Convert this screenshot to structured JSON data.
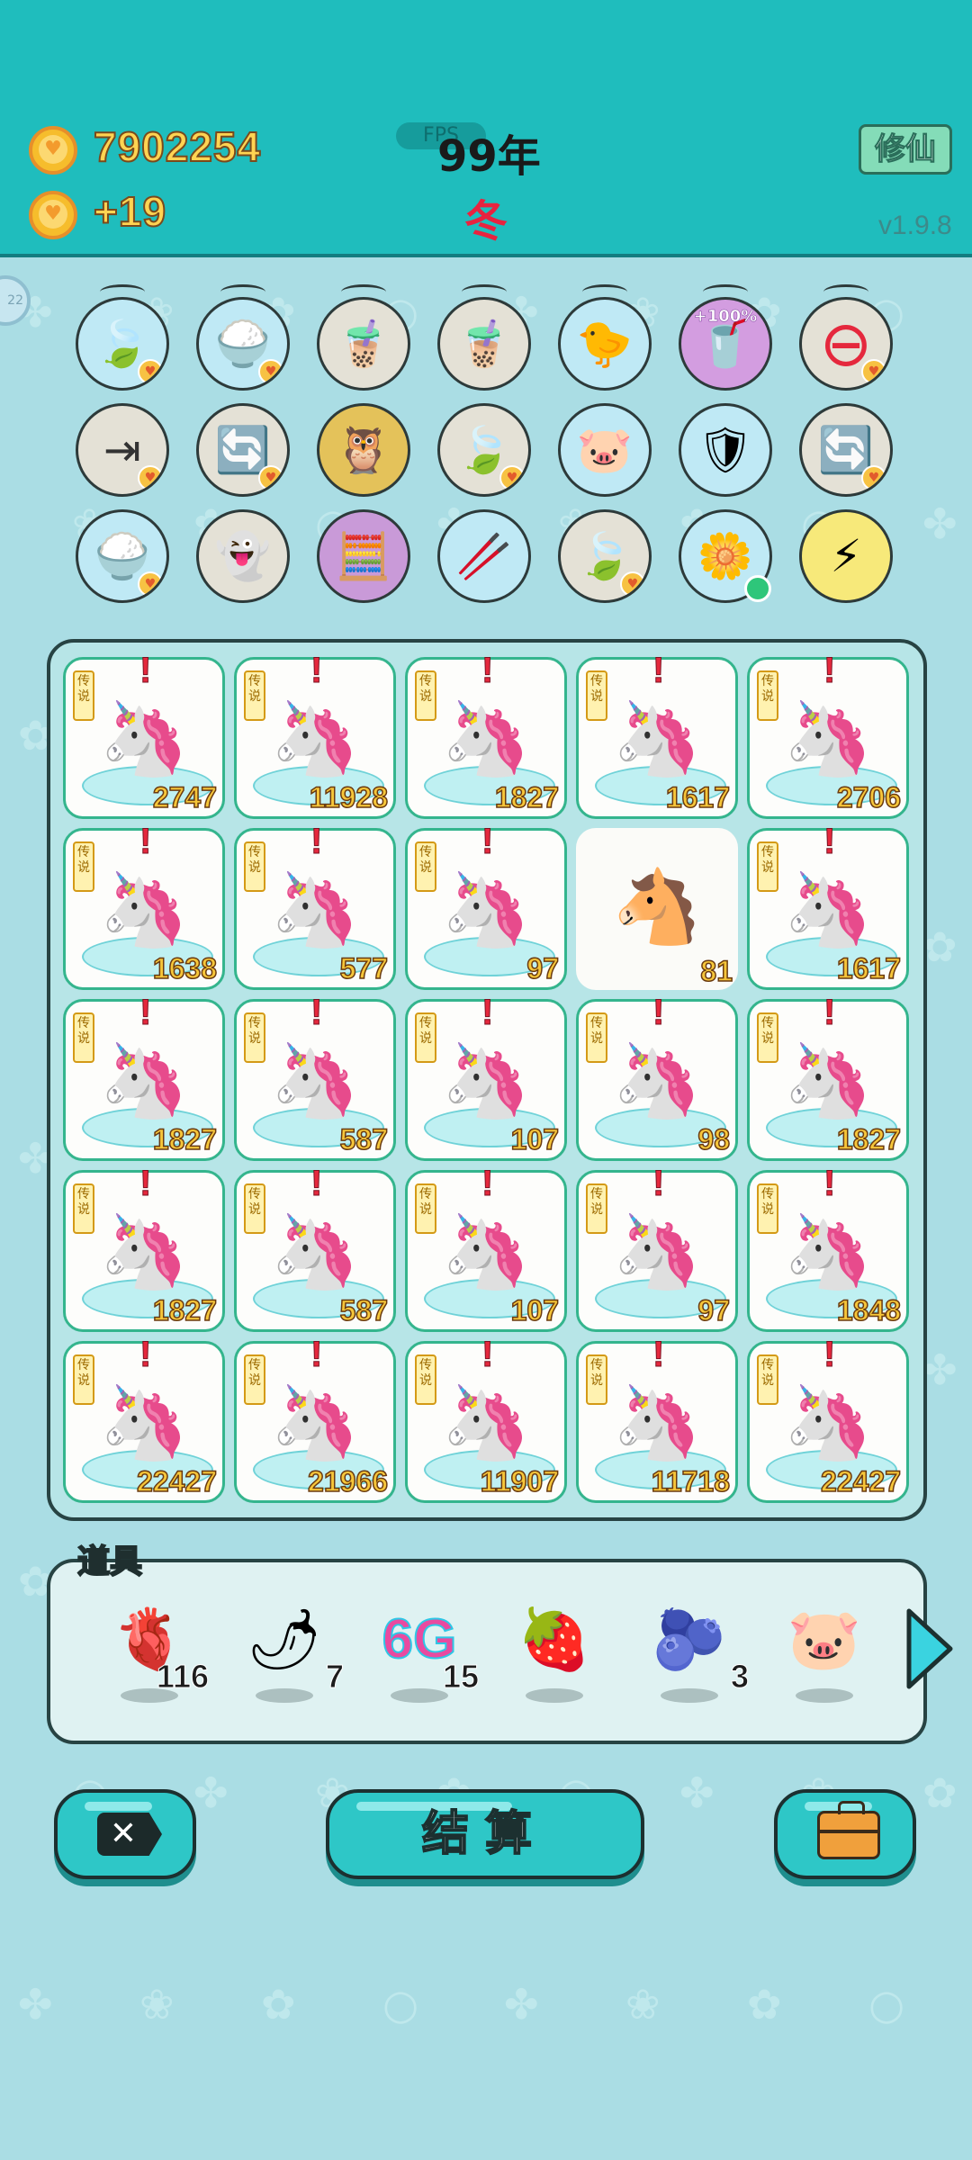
{
  "header": {
    "coins": "7902254",
    "coin_rate": "+19",
    "fps_label": "FPS",
    "year": "99年",
    "season": "冬",
    "mode_button": "修仙",
    "version": "v1.9.8"
  },
  "skills": [
    {
      "icon": "leaf-icon",
      "glyph": "🍃",
      "bg": "#bfe9f5",
      "badge": true
    },
    {
      "icon": "rice-bowl-icon",
      "glyph": "🍚",
      "bg": "#bfe9f5",
      "badge": true
    },
    {
      "icon": "bubble-tea-icon",
      "glyph": "🧋",
      "bg": "#e4e1d6",
      "badge": false
    },
    {
      "icon": "bubble-tea-icon",
      "glyph": "🧋",
      "bg": "#e4e1d6",
      "badge": false
    },
    {
      "icon": "chick-egg-icon",
      "glyph": "🐤",
      "bg": "#bfe9f5",
      "badge": false
    },
    {
      "icon": "bubble-tea-plus-icon",
      "glyph": "🥤",
      "bg": "#d39de0",
      "badge": false,
      "text": "+100%"
    },
    {
      "icon": "minus-icon",
      "glyph": "⊖",
      "bg": "#e4e1d6",
      "badge": true
    },
    {
      "icon": "skip-icon",
      "glyph": "⇥",
      "bg": "#e4e1d6",
      "badge": true
    },
    {
      "icon": "refresh-icon",
      "glyph": "🔄",
      "bg": "#e4e1d6",
      "badge": true
    },
    {
      "icon": "owls-icon",
      "glyph": "🦉",
      "bg": "#e4c25a",
      "badge": false
    },
    {
      "icon": "leaf-icon",
      "glyph": "🍃",
      "bg": "#e4e1d6",
      "badge": true
    },
    {
      "icon": "piggy-bank-icon",
      "glyph": "🐷",
      "bg": "#bfe9f5",
      "badge": false
    },
    {
      "icon": "shield-wrench-icon",
      "glyph": "🛡",
      "bg": "#bfe9f5",
      "badge": false
    },
    {
      "icon": "refresh-icon",
      "glyph": "🔄",
      "bg": "#e4e1d6",
      "badge": true
    },
    {
      "icon": "rice-bowl-icon",
      "glyph": "🍚",
      "bg": "#bfe9f5",
      "badge": true
    },
    {
      "icon": "ghost-icon",
      "glyph": "👻",
      "bg": "#e4e1d6",
      "badge": false
    },
    {
      "icon": "math-brain-icon",
      "glyph": "🧮",
      "bg": "#c99ad8",
      "badge": false
    },
    {
      "icon": "chopsticks-icon",
      "glyph": "🥢",
      "bg": "#bfe9f5",
      "badge": false
    },
    {
      "icon": "leaf-icon",
      "glyph": "🍃",
      "bg": "#e4e1d6",
      "badge": true
    },
    {
      "icon": "flower-pot-icon",
      "glyph": "🌼",
      "bg": "#bfe9f5",
      "badge": false
    },
    {
      "icon": "lightning-icon",
      "glyph": "⚡",
      "bg": "#f7e97a",
      "badge": false
    }
  ],
  "board": {
    "legend_label": "传说",
    "cells": [
      {
        "value": "2747",
        "type": "unicorn"
      },
      {
        "value": "11928",
        "type": "unicorn"
      },
      {
        "value": "1827",
        "type": "unicorn"
      },
      {
        "value": "1617",
        "type": "unicorn"
      },
      {
        "value": "2706",
        "type": "unicorn"
      },
      {
        "value": "1638",
        "type": "unicorn"
      },
      {
        "value": "577",
        "type": "unicorn"
      },
      {
        "value": "97",
        "type": "unicorn"
      },
      {
        "value": "81",
        "type": "horse"
      },
      {
        "value": "1617",
        "type": "unicorn"
      },
      {
        "value": "1827",
        "type": "unicorn"
      },
      {
        "value": "587",
        "type": "unicorn"
      },
      {
        "value": "107",
        "type": "unicorn"
      },
      {
        "value": "98",
        "type": "unicorn"
      },
      {
        "value": "1827",
        "type": "unicorn"
      },
      {
        "value": "1827",
        "type": "unicorn"
      },
      {
        "value": "587",
        "type": "unicorn"
      },
      {
        "value": "107",
        "type": "unicorn"
      },
      {
        "value": "97",
        "type": "unicorn"
      },
      {
        "value": "1848",
        "type": "unicorn"
      },
      {
        "value": "22427",
        "type": "unicorn"
      },
      {
        "value": "21966",
        "type": "unicorn"
      },
      {
        "value": "11907",
        "type": "unicorn"
      },
      {
        "value": "11718",
        "type": "unicorn"
      },
      {
        "value": "22427",
        "type": "unicorn"
      }
    ]
  },
  "items": {
    "title": "道具",
    "list": [
      {
        "icon": "liver-icon",
        "glyph": "🫀",
        "count": "116"
      },
      {
        "icon": "chili-icon",
        "glyph": "🌶",
        "count": "7"
      },
      {
        "icon": "6g-icon",
        "glyph": "6G",
        "count": "15"
      },
      {
        "icon": "strawberry-icon",
        "glyph": "🍓",
        "count": ""
      },
      {
        "icon": "blueberry-icon",
        "glyph": "🫐",
        "count": "3"
      },
      {
        "icon": "piggy-bank-icon",
        "glyph": "🐷",
        "count": ""
      }
    ]
  },
  "buttons": {
    "settle_label": "结算"
  }
}
